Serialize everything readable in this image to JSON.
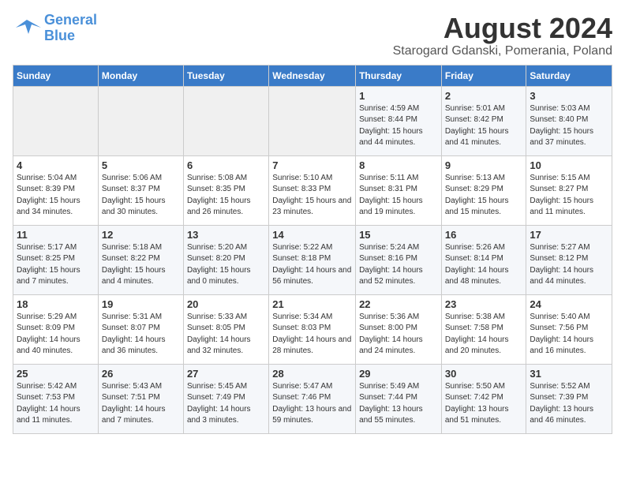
{
  "header": {
    "logo_line1": "General",
    "logo_line2": "Blue",
    "month_title": "August 2024",
    "subtitle": "Starogard Gdanski, Pomerania, Poland"
  },
  "days_of_week": [
    "Sunday",
    "Monday",
    "Tuesday",
    "Wednesday",
    "Thursday",
    "Friday",
    "Saturday"
  ],
  "weeks": [
    [
      {
        "day": "",
        "info": ""
      },
      {
        "day": "",
        "info": ""
      },
      {
        "day": "",
        "info": ""
      },
      {
        "day": "",
        "info": ""
      },
      {
        "day": "1",
        "info": "Sunrise: 4:59 AM\nSunset: 8:44 PM\nDaylight: 15 hours and 44 minutes."
      },
      {
        "day": "2",
        "info": "Sunrise: 5:01 AM\nSunset: 8:42 PM\nDaylight: 15 hours and 41 minutes."
      },
      {
        "day": "3",
        "info": "Sunrise: 5:03 AM\nSunset: 8:40 PM\nDaylight: 15 hours and 37 minutes."
      }
    ],
    [
      {
        "day": "4",
        "info": "Sunrise: 5:04 AM\nSunset: 8:39 PM\nDaylight: 15 hours and 34 minutes."
      },
      {
        "day": "5",
        "info": "Sunrise: 5:06 AM\nSunset: 8:37 PM\nDaylight: 15 hours and 30 minutes."
      },
      {
        "day": "6",
        "info": "Sunrise: 5:08 AM\nSunset: 8:35 PM\nDaylight: 15 hours and 26 minutes."
      },
      {
        "day": "7",
        "info": "Sunrise: 5:10 AM\nSunset: 8:33 PM\nDaylight: 15 hours and 23 minutes."
      },
      {
        "day": "8",
        "info": "Sunrise: 5:11 AM\nSunset: 8:31 PM\nDaylight: 15 hours and 19 minutes."
      },
      {
        "day": "9",
        "info": "Sunrise: 5:13 AM\nSunset: 8:29 PM\nDaylight: 15 hours and 15 minutes."
      },
      {
        "day": "10",
        "info": "Sunrise: 5:15 AM\nSunset: 8:27 PM\nDaylight: 15 hours and 11 minutes."
      }
    ],
    [
      {
        "day": "11",
        "info": "Sunrise: 5:17 AM\nSunset: 8:25 PM\nDaylight: 15 hours and 7 minutes."
      },
      {
        "day": "12",
        "info": "Sunrise: 5:18 AM\nSunset: 8:22 PM\nDaylight: 15 hours and 4 minutes."
      },
      {
        "day": "13",
        "info": "Sunrise: 5:20 AM\nSunset: 8:20 PM\nDaylight: 15 hours and 0 minutes."
      },
      {
        "day": "14",
        "info": "Sunrise: 5:22 AM\nSunset: 8:18 PM\nDaylight: 14 hours and 56 minutes."
      },
      {
        "day": "15",
        "info": "Sunrise: 5:24 AM\nSunset: 8:16 PM\nDaylight: 14 hours and 52 minutes."
      },
      {
        "day": "16",
        "info": "Sunrise: 5:26 AM\nSunset: 8:14 PM\nDaylight: 14 hours and 48 minutes."
      },
      {
        "day": "17",
        "info": "Sunrise: 5:27 AM\nSunset: 8:12 PM\nDaylight: 14 hours and 44 minutes."
      }
    ],
    [
      {
        "day": "18",
        "info": "Sunrise: 5:29 AM\nSunset: 8:09 PM\nDaylight: 14 hours and 40 minutes."
      },
      {
        "day": "19",
        "info": "Sunrise: 5:31 AM\nSunset: 8:07 PM\nDaylight: 14 hours and 36 minutes."
      },
      {
        "day": "20",
        "info": "Sunrise: 5:33 AM\nSunset: 8:05 PM\nDaylight: 14 hours and 32 minutes."
      },
      {
        "day": "21",
        "info": "Sunrise: 5:34 AM\nSunset: 8:03 PM\nDaylight: 14 hours and 28 minutes."
      },
      {
        "day": "22",
        "info": "Sunrise: 5:36 AM\nSunset: 8:00 PM\nDaylight: 14 hours and 24 minutes."
      },
      {
        "day": "23",
        "info": "Sunrise: 5:38 AM\nSunset: 7:58 PM\nDaylight: 14 hours and 20 minutes."
      },
      {
        "day": "24",
        "info": "Sunrise: 5:40 AM\nSunset: 7:56 PM\nDaylight: 14 hours and 16 minutes."
      }
    ],
    [
      {
        "day": "25",
        "info": "Sunrise: 5:42 AM\nSunset: 7:53 PM\nDaylight: 14 hours and 11 minutes."
      },
      {
        "day": "26",
        "info": "Sunrise: 5:43 AM\nSunset: 7:51 PM\nDaylight: 14 hours and 7 minutes."
      },
      {
        "day": "27",
        "info": "Sunrise: 5:45 AM\nSunset: 7:49 PM\nDaylight: 14 hours and 3 minutes."
      },
      {
        "day": "28",
        "info": "Sunrise: 5:47 AM\nSunset: 7:46 PM\nDaylight: 13 hours and 59 minutes."
      },
      {
        "day": "29",
        "info": "Sunrise: 5:49 AM\nSunset: 7:44 PM\nDaylight: 13 hours and 55 minutes."
      },
      {
        "day": "30",
        "info": "Sunrise: 5:50 AM\nSunset: 7:42 PM\nDaylight: 13 hours and 51 minutes."
      },
      {
        "day": "31",
        "info": "Sunrise: 5:52 AM\nSunset: 7:39 PM\nDaylight: 13 hours and 46 minutes."
      }
    ]
  ]
}
